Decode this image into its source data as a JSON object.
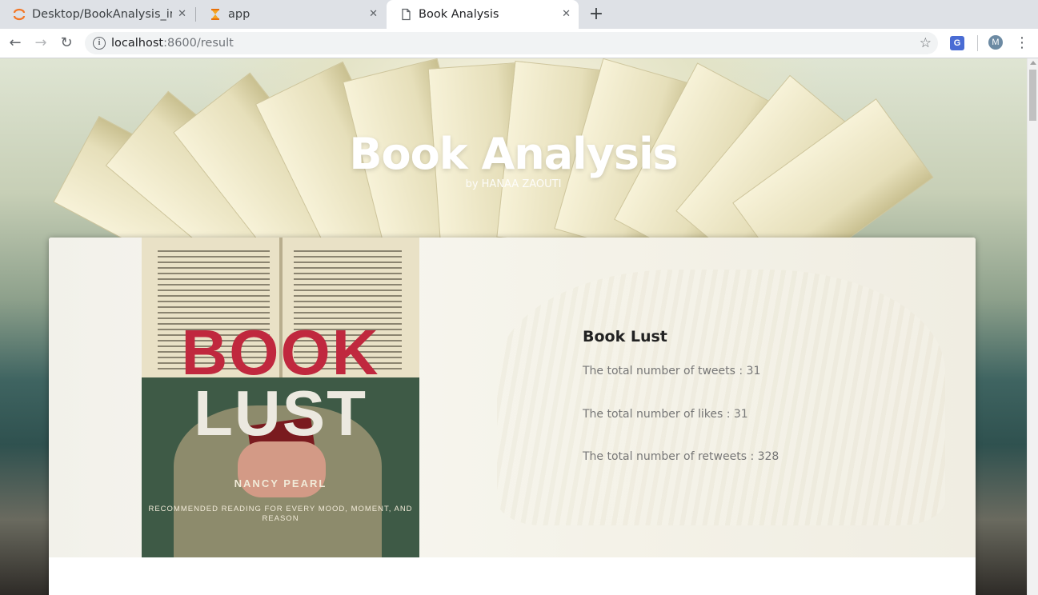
{
  "browser": {
    "tabs": [
      {
        "title": "Desktop/BookAnalysis_in",
        "icon": "jupyter-icon"
      },
      {
        "title": "app",
        "icon": "hourglass-icon"
      },
      {
        "title": "Book Analysis",
        "icon": "document-icon"
      }
    ],
    "active_tab": 2,
    "url_host": "localhost",
    "url_path": ":8600/result",
    "avatar_letter": "M",
    "extension_letter": "G"
  },
  "hero": {
    "title": "Book Analysis",
    "subtitle": "by HANAA ZAOUTI"
  },
  "book": {
    "title": "Book Lust",
    "cover": {
      "title_line1": "BOOK",
      "title_line2": "LUST",
      "author": "NANCY PEARL",
      "tagline": "RECOMMENDED READING FOR EVERY MOOD, MOMENT, AND REASON"
    },
    "stats": [
      {
        "label": "The total number of tweets : 31"
      },
      {
        "label": "The total number of likes : 31"
      },
      {
        "label": "The total number of retweets : 328"
      }
    ]
  },
  "colors": {
    "cover_red": "#c0283e",
    "cover_green": "#3e5a46",
    "stat_text": "#777777"
  }
}
